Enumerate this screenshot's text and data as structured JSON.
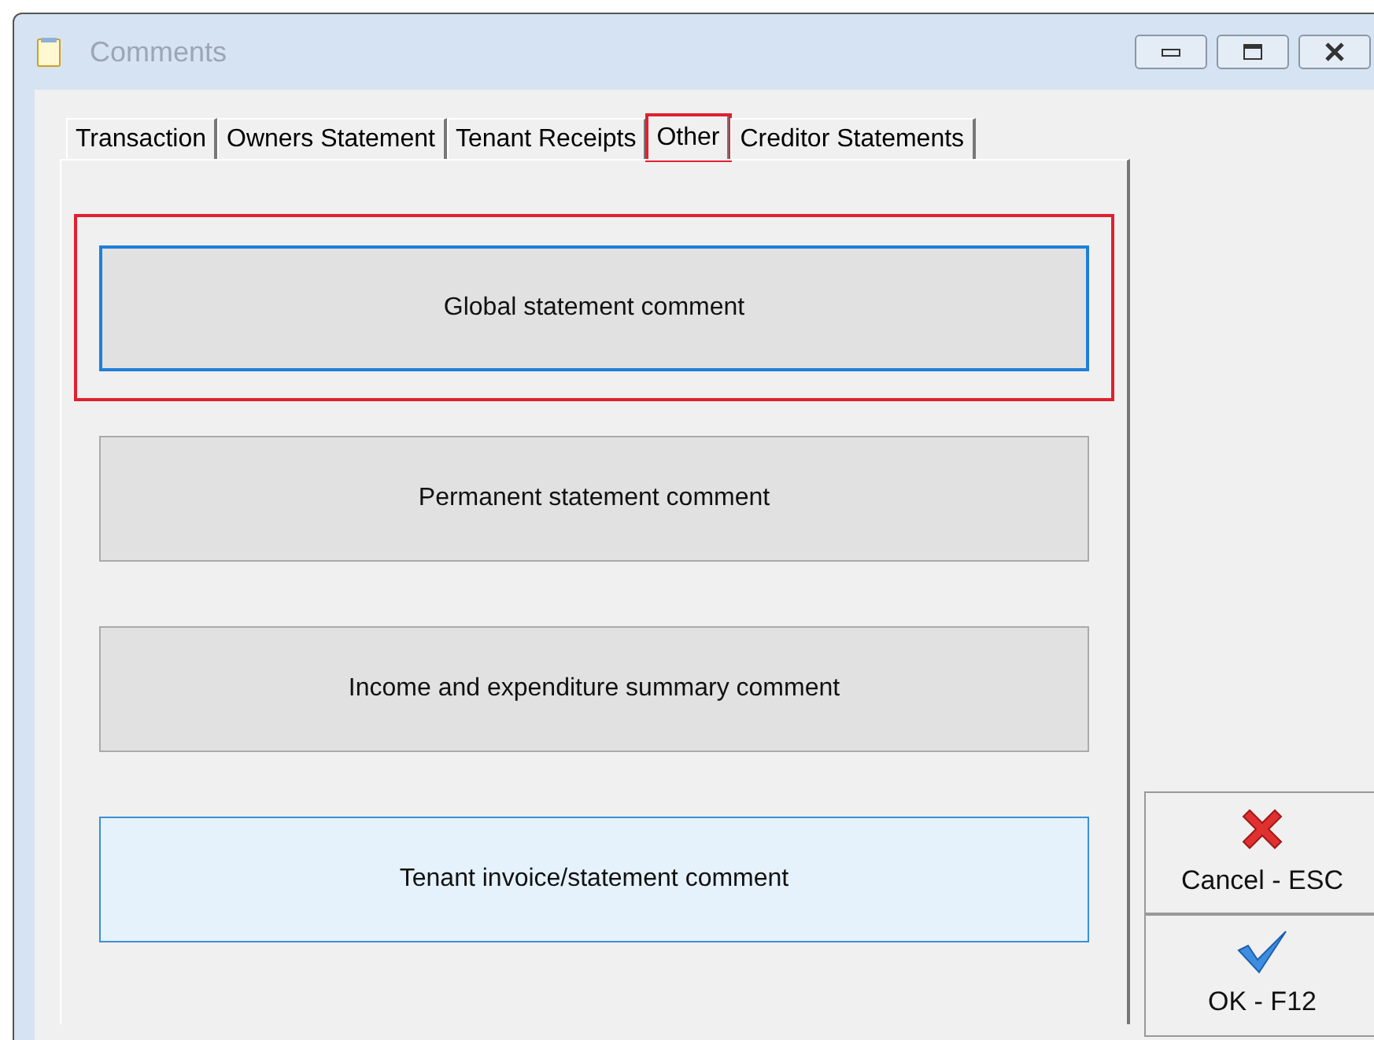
{
  "window": {
    "title": "Comments"
  },
  "tabs": [
    {
      "label": "Transaction",
      "selected": false,
      "highlighted": false
    },
    {
      "label": "Owners Statement",
      "selected": false,
      "highlighted": false
    },
    {
      "label": "Tenant Receipts",
      "selected": false,
      "highlighted": false
    },
    {
      "label": "Other",
      "selected": true,
      "highlighted": true
    },
    {
      "label": "Creditor Statements",
      "selected": false,
      "highlighted": false
    }
  ],
  "comment_buttons": [
    {
      "label": "Global statement comment",
      "focused": true,
      "hovered": false,
      "highlighted": true
    },
    {
      "label": "Permanent statement comment",
      "focused": false,
      "hovered": false,
      "highlighted": false
    },
    {
      "label": "Income and expenditure summary comment",
      "focused": false,
      "hovered": false,
      "highlighted": false
    },
    {
      "label": "Tenant invoice/statement comment",
      "focused": false,
      "hovered": true,
      "highlighted": false
    }
  ],
  "actions": [
    {
      "kind": "cancel",
      "label": "Cancel - ESC"
    },
    {
      "kind": "ok",
      "label": "OK - F12"
    }
  ]
}
